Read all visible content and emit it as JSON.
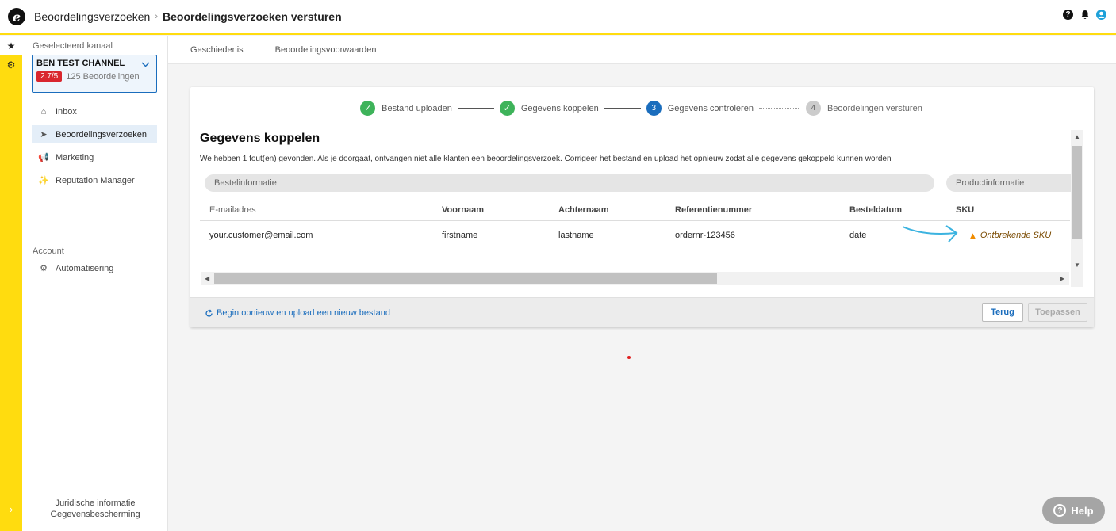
{
  "topbar": {
    "logo": "e",
    "breadcrumb_parent": "Beoordelingsverzoeken",
    "breadcrumb_separator": "›",
    "breadcrumb_current": "Beoordelingsverzoeken versturen",
    "help_glyph": "?"
  },
  "rail": {
    "star": "★",
    "gear": "⚙",
    "expand": "›"
  },
  "sidebar": {
    "channel_label": "Geselecteerd kanaal",
    "channel_name": "BEN TEST CHANNEL",
    "rating": "2.7/5",
    "review_count": "125 Beoordelingen",
    "items": [
      {
        "label": "Inbox",
        "icon": "inbox-icon",
        "glyph": "⌂"
      },
      {
        "label": "Beoordelingsverzoeken",
        "icon": "send-icon",
        "glyph": "➤"
      },
      {
        "label": "Marketing",
        "icon": "megaphone-icon",
        "glyph": "📢"
      },
      {
        "label": "Reputation Manager",
        "icon": "sparkle-icon",
        "glyph": "✨"
      }
    ],
    "account_label": "Account",
    "account_items": [
      {
        "label": "Automatisering",
        "icon": "gears-icon",
        "glyph": "⚙"
      }
    ],
    "legal_1": "Juridische informatie",
    "legal_2": "Gegevensbescherming"
  },
  "tabs": [
    "Geschiedenis",
    "Beoordelingsvoorwaarden"
  ],
  "stepper": [
    {
      "label": "Bestand uploaden",
      "state": "done",
      "glyph": "✓"
    },
    {
      "label": "Gegevens koppelen",
      "state": "done",
      "glyph": "✓"
    },
    {
      "label": "Gegevens controleren",
      "state": "current",
      "glyph": "3"
    },
    {
      "label": "Beoordelingen versturen",
      "state": "todo",
      "glyph": "4"
    }
  ],
  "content": {
    "heading": "Gegevens koppelen",
    "notice": "We hebben 1 fout(en) gevonden. Als je doorgaat, ontvangen niet alle klanten een beoordelingsverzoek. Corrigeer het bestand en upload het opnieuw zodat alle gegevens gekoppeld kunnen worden",
    "group_order": "Bestelinformatie",
    "group_product": "Productinformatie"
  },
  "table": {
    "columns": [
      "E-mailadres",
      "Voornaam",
      "Achternaam",
      "Referentienummer",
      "Besteldatum",
      "SKU"
    ],
    "row": [
      "your.customer@email.com",
      "firstname",
      "lastname",
      "ordernr-123456",
      "date"
    ],
    "sku_warning": "Ontbrekende SKU",
    "warning_glyph": "▲"
  },
  "footer": {
    "restart_label": "Begin opnieuw en upload een nieuw bestand",
    "back_label": "Terug",
    "apply_label": "Toepassen"
  },
  "help_label": "Help"
}
